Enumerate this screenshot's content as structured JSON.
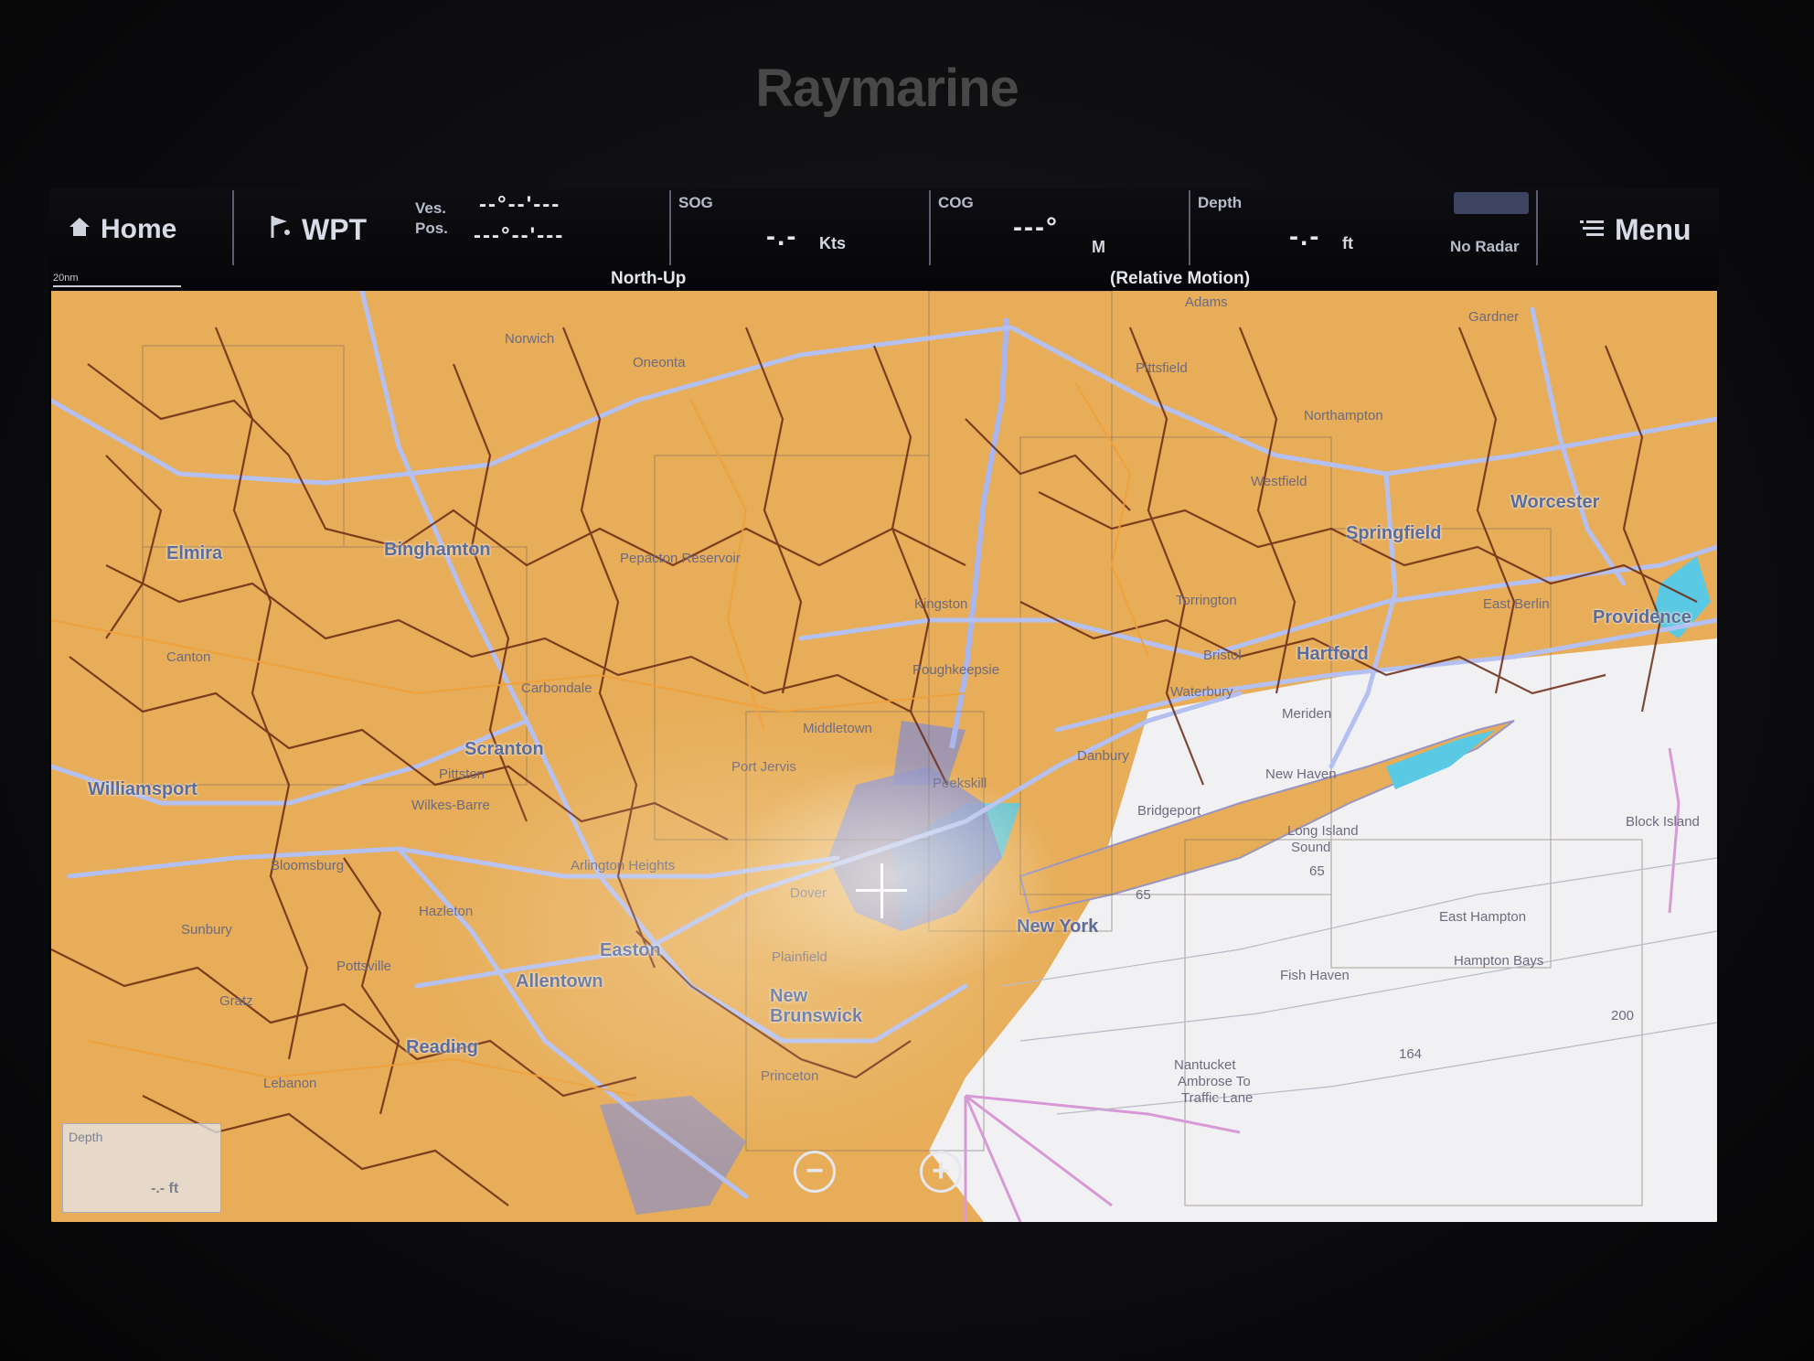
{
  "device": {
    "brand": "Raymarine"
  },
  "databar": {
    "home_label": "Home",
    "wpt_label": "WPT",
    "ves_pos_label_1": "Ves.",
    "ves_pos_label_2": "Pos.",
    "ves_pos_line_1": "--°--'---",
    "ves_pos_line_2": "---°--'---",
    "sog_label": "SOG",
    "sog_value": "-.-",
    "sog_unit": "Kts",
    "cog_label": "COG",
    "cog_value": "---°",
    "cog_unit": "M",
    "depth_label": "Depth",
    "depth_value": "-.-",
    "depth_unit": "ft",
    "radar_status": "No Radar",
    "menu_label": "Menu",
    "orientation": "North-Up",
    "motion_mode": "(Relative Motion)",
    "scale_label": "20nm"
  },
  "map": {
    "major_places": [
      "Elmira",
      "Binghamton",
      "Scranton",
      "Williamsport",
      "Easton",
      "Allentown",
      "Reading",
      "New",
      "Brunswick",
      "New York",
      "Hartford",
      "Springfield",
      "Worcester",
      "Providence"
    ],
    "minor_places": [
      "Norwich",
      "Oneonta",
      "Pepacton Reservoir",
      "Kingston",
      "Poughkeepsie",
      "Middletown",
      "Port Jervis",
      "Carbondale",
      "Pittston",
      "Wilkes-Barre",
      "Bloomsburg",
      "Hazleton",
      "Pottsville",
      "Arlington Heights",
      "Dover",
      "Plainfield",
      "Princeton",
      "Sunbury",
      "Gratz",
      "Lebanon",
      "Pittsfield",
      "Northampton",
      "Westfield",
      "Torrington",
      "Bristol",
      "Waterbury",
      "Danbury",
      "Peekskill",
      "Bridgeport",
      "New Haven",
      "Long Island",
      "Sound",
      "Fish Haven",
      "East Hampton",
      "Nantucket",
      "Ambrose To",
      "Traffic Lane",
      "Canton",
      "Adams",
      "Gardner",
      "East Berlin",
      "Meriden",
      "Block Island",
      "Hampton Bays"
    ],
    "sounding_labels": [
      "65",
      "65",
      "164",
      "200"
    ],
    "depth_box_label": "Depth",
    "depth_box_value": "-.- ft",
    "zoom_out_symbol": "−",
    "zoom_in_symbol": "+"
  },
  "colors": {
    "land": "#e7ad58",
    "water": "#f1f1f3",
    "highway": "#a9b6ef",
    "road": "#6a2a16",
    "urban": "#8f90c4",
    "label": "#5b6b9c"
  }
}
